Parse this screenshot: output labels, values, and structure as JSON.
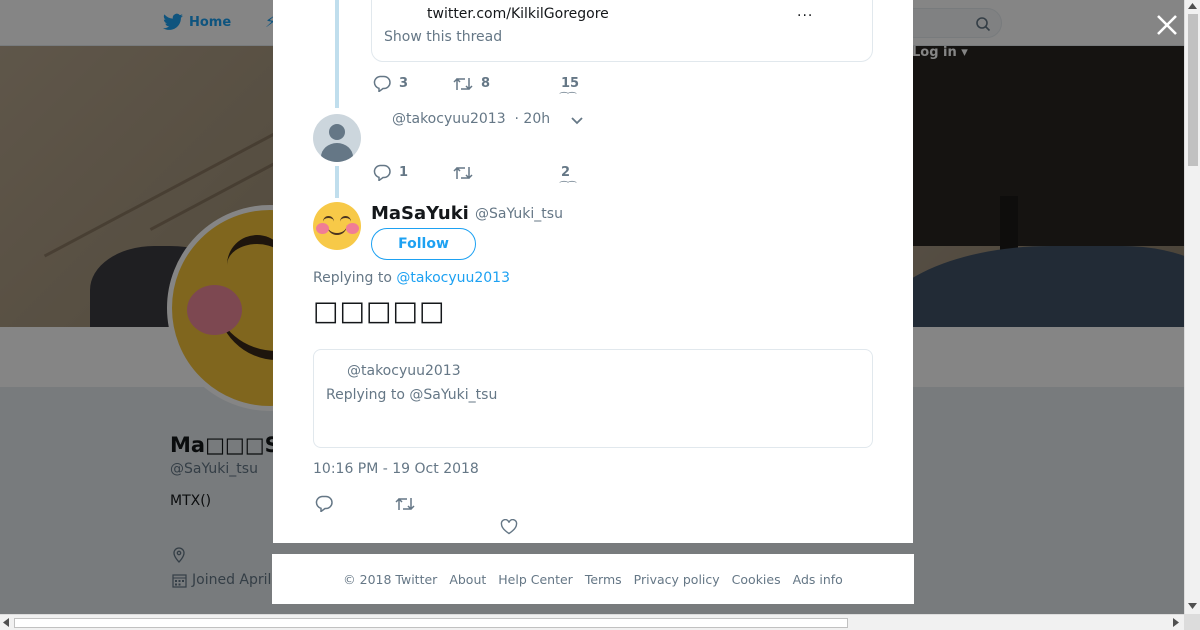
{
  "background": {
    "nav": {
      "home_label": "Home",
      "login_label": "Log in"
    },
    "profile": {
      "name": "Ma□□□Sa",
      "handle": "@SaYuki_tsu",
      "bio": "MTX()",
      "joined": "Joined April"
    }
  },
  "thread": {
    "top_card": {
      "url": "twitter.com/KilkilGoregore",
      "more": "...",
      "show_thread": "Show this thread"
    },
    "top_actions": {
      "replies": "3",
      "retweets": "8",
      "likes": "15"
    },
    "reply": {
      "handle": "@takocyuu2013",
      "time": "· 20h"
    },
    "reply_actions": {
      "replies": "1",
      "retweets": "",
      "likes": "2"
    }
  },
  "tweet": {
    "name": "MaSaYuki",
    "handle": "@SaYuki_tsu",
    "follow_label": "Follow",
    "replying_prefix": "Replying to",
    "replying_to": "@takocyuu2013",
    "text": "□□□□□",
    "quote": {
      "handle": "@takocyuu2013",
      "replying": "Replying to @SaYuki_tsu"
    },
    "timestamp": "10:16 PM - 19 Oct 2018"
  },
  "footer": {
    "links": [
      "© 2018 Twitter",
      "About",
      "Help Center",
      "Terms",
      "Privacy policy",
      "Cookies",
      "Ads info"
    ]
  },
  "colors": {
    "brand": "#1da1f2",
    "muted": "#657786",
    "thread_line": "#c0deed"
  }
}
